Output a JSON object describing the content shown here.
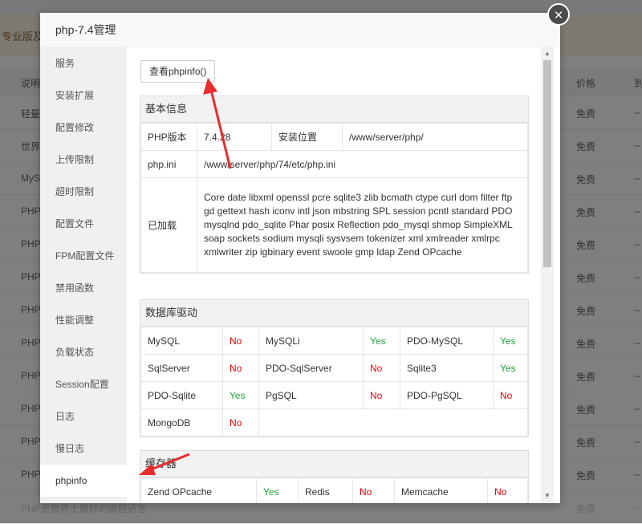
{
  "background": {
    "notice": "专业版及",
    "header": {
      "desc": "说明",
      "price": "价格",
      "due": "到"
    },
    "rows": [
      {
        "desc": "轻量",
        "price": "免费",
        "due": "--"
      },
      {
        "desc": "世界",
        "price": "免费",
        "due": "--"
      },
      {
        "desc": "MyS",
        "price": "免费",
        "due": "--"
      },
      {
        "desc": "PHP",
        "price": "免费",
        "due": "--"
      },
      {
        "desc": "PHP",
        "price": "免费",
        "due": "--"
      },
      {
        "desc": "PHP",
        "price": "免费",
        "due": "--"
      },
      {
        "desc": "PHP",
        "price": "免费",
        "due": "--"
      },
      {
        "desc": "PHP",
        "price": "免费",
        "due": "--"
      },
      {
        "desc": "PHP",
        "price": "免费",
        "due": "--"
      },
      {
        "desc": "PHP",
        "price": "免费",
        "due": "--"
      },
      {
        "desc": "PHP",
        "price": "免费",
        "due": "--"
      },
      {
        "desc": "PHP",
        "price": "免费",
        "due": "--"
      },
      {
        "desc": "PHP是世界上最好的编程语言",
        "price": "免费",
        "due": "--"
      }
    ]
  },
  "modal": {
    "title": "php-7.4管理",
    "close": "×"
  },
  "sidebar": {
    "items": [
      "服务",
      "安装扩展",
      "配置修改",
      "上传限制",
      "超时限制",
      "配置文件",
      "FPM配置文件",
      "禁用函数",
      "性能调整",
      "负载状态",
      "Session配置",
      "日志",
      "慢日志",
      "phpinfo"
    ]
  },
  "content": {
    "phpinfo_button": "查看phpinfo()",
    "basic": {
      "title": "基本信息",
      "php_version_label": "PHP版本",
      "php_version": "7.4.28",
      "install_label": "安装位置",
      "install_path": "/www/server/php/",
      "ini_label": "php.ini",
      "ini_path": "/www/server/php/74/etc/php.ini",
      "loaded_label": "已加载",
      "loaded": "Core date libxml openssl pcre sqlite3 zlib bcmath ctype curl dom filter ftp gd gettext hash iconv intl json mbstring SPL session pcntl standard PDO mysqlnd pdo_sqlite Phar posix Reflection pdo_mysql shmop SimpleXML soap sockets sodium mysqli sysvsem tokenizer xml xmlreader xmlrpc xmlwriter zip igbinary event swoole gmp ldap Zend OPcache"
    },
    "db": {
      "title": "数据库驱动",
      "rows": [
        [
          {
            "k": "MySQL",
            "v": "No"
          },
          {
            "k": "MySQLi",
            "v": "Yes"
          },
          {
            "k": "PDO-MySQL",
            "v": "Yes"
          }
        ],
        [
          {
            "k": "SqlServer",
            "v": "No"
          },
          {
            "k": "PDO-SqlServer",
            "v": "No"
          },
          {
            "k": "Sqlite3",
            "v": "Yes"
          }
        ],
        [
          {
            "k": "PDO-Sqlite",
            "v": "Yes"
          },
          {
            "k": "PgSQL",
            "v": "No"
          },
          {
            "k": "PDO-PgSQL",
            "v": "No"
          }
        ],
        [
          {
            "k": "MongoDB",
            "v": "No"
          }
        ]
      ]
    },
    "cache": {
      "title": "缓存器",
      "rows": [
        [
          {
            "k": "Zend OPcache",
            "v": "Yes"
          },
          {
            "k": "Redis",
            "v": "No"
          },
          {
            "k": "Memcache",
            "v": "No"
          }
        ]
      ]
    }
  },
  "colors": {
    "yes": "#20a53a",
    "no": "#e80000",
    "arrow": "#e82c2c"
  }
}
